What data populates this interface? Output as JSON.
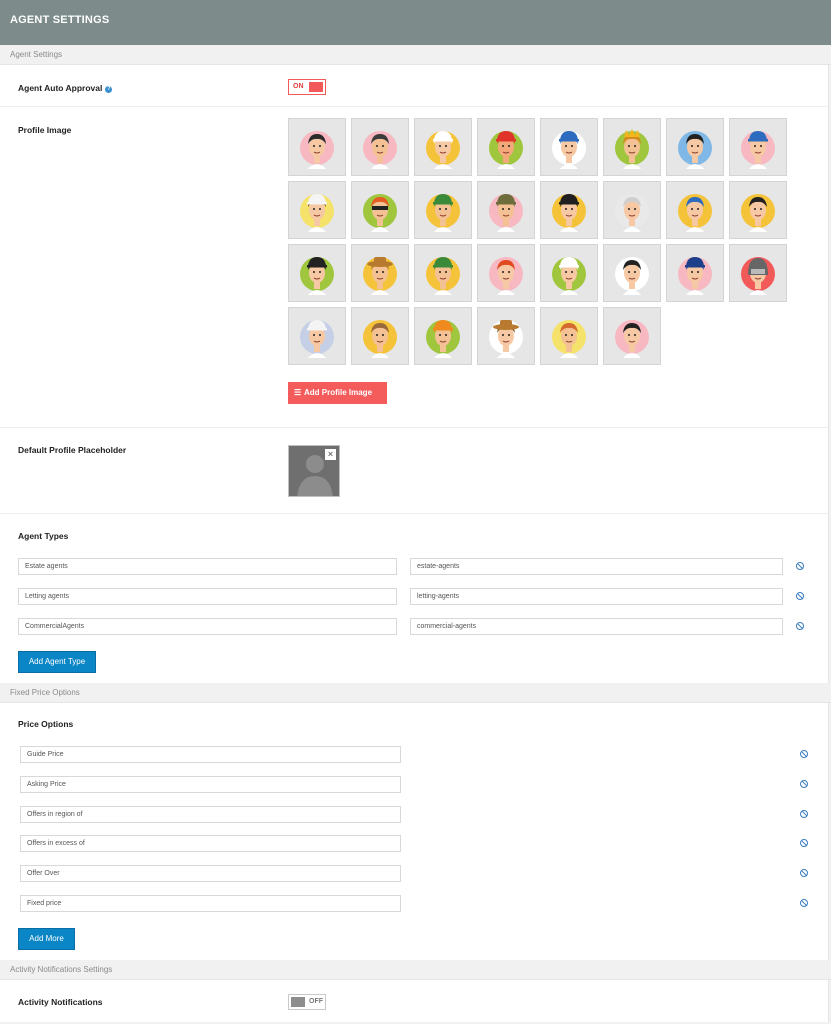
{
  "header": {
    "title": "AGENT SETTINGS"
  },
  "sections": {
    "agent_settings": "Agent Settings",
    "fixed_price": "Fixed Price Options",
    "activity": "Activity Notifications Settings"
  },
  "auto_approval": {
    "label": "Agent Auto Approval",
    "help_icon": "question-icon",
    "toggle_label": "ON",
    "enabled": true
  },
  "profile_image": {
    "label": "Profile Image",
    "avatars": [
      {
        "skin": "#f6c9a4",
        "hair": "#2b2b2b",
        "bg": "#f7b8c1",
        "hat": "none"
      },
      {
        "skin": "#f3c193",
        "hair": "#3b3b3b",
        "bg": "#f7b8c1",
        "hat": "none"
      },
      {
        "skin": "#f6c9a4",
        "hair": "#ffffff",
        "bg": "#f5c33a",
        "hat": "chef"
      },
      {
        "skin": "#f3a97a",
        "hair": "#e04a1e",
        "bg": "#9fc63c",
        "hat": "cap-red"
      },
      {
        "skin": "#f6c9a4",
        "hair": "#2d6bbf",
        "bg": "#ffffff",
        "hat": "cap-blue"
      },
      {
        "skin": "#f3c193",
        "hair": "#d48a1c",
        "bg": "#9fc63c",
        "hat": "crown"
      },
      {
        "skin": "#f6c9a4",
        "hair": "#222222",
        "bg": "#7fb7e6",
        "hat": "none"
      },
      {
        "skin": "#f6c9a4",
        "hair": "#f2c641",
        "bg": "#f7b8c1",
        "hat": "cap-blue"
      },
      {
        "skin": "#f6c9a4",
        "hair": "#6b4324",
        "bg": "#f5e26a",
        "hat": "white"
      },
      {
        "skin": "#f3c193",
        "hair": "#e45b24",
        "bg": "#9fc63c",
        "hat": "mask"
      },
      {
        "skin": "#f3c193",
        "hair": "#3a8a3a",
        "bg": "#f5c33a",
        "hat": "cap-green"
      },
      {
        "skin": "#f3c193",
        "hair": "#6e6e3c",
        "bg": "#f7b8c1",
        "hat": "army"
      },
      {
        "skin": "#f6c9a4",
        "hair": "#222222",
        "bg": "#f5c33a",
        "hat": "pirate"
      },
      {
        "skin": "#f6c9a4",
        "hair": "#cfcfcf",
        "bg": "#e9e9e9",
        "hat": "none"
      },
      {
        "skin": "#f6c9a4",
        "hair": "#2d6bbf",
        "bg": "#f5c33a",
        "hat": "none"
      },
      {
        "skin": "#f6c9a4",
        "hair": "#222222",
        "bg": "#f5c33a",
        "hat": "none"
      },
      {
        "skin": "#f6c9a4",
        "hair": "#222222",
        "bg": "#9fc63c",
        "hat": "officer"
      },
      {
        "skin": "#f3c193",
        "hair": "#b77a2e",
        "bg": "#f5c33a",
        "hat": "cowboy"
      },
      {
        "skin": "#f3c193",
        "hair": "#4c8a4c",
        "bg": "#f5c33a",
        "hat": "cap-green"
      },
      {
        "skin": "#f6c9a4",
        "hair": "#e04a1e",
        "bg": "#f7b8c1",
        "hat": "none"
      },
      {
        "skin": "#f6c9a4",
        "hair": "#ffffff",
        "bg": "#9fc63c",
        "hat": "sailor"
      },
      {
        "skin": "#f6c9a4",
        "hair": "#222222",
        "bg": "#ffffff",
        "hat": "none"
      },
      {
        "skin": "#f6c9a4",
        "hair": "#2d4fa0",
        "bg": "#f7b8c1",
        "hat": "police"
      },
      {
        "skin": "#f6c9a4",
        "hair": "#555555",
        "bg": "#f25a5a",
        "hat": "helmet"
      },
      {
        "skin": "#f6c9a4",
        "hair": "#b8c8e0",
        "bg": "#c5cfe6",
        "hat": "white"
      },
      {
        "skin": "#f3c193",
        "hair": "#9a6a3a",
        "bg": "#f5c33a",
        "hat": "none"
      },
      {
        "skin": "#f3c193",
        "hair": "#f08a1e",
        "bg": "#9fc63c",
        "hat": "cap-orange"
      },
      {
        "skin": "#f6c9a4",
        "hair": "#8a5a2e",
        "bg": "#ffffff",
        "hat": "cowboy"
      },
      {
        "skin": "#f3c193",
        "hair": "#d46a2e",
        "bg": "#f5e26a",
        "hat": "none"
      },
      {
        "skin": "#f6c9a4",
        "hair": "#222222",
        "bg": "#f7b8c1",
        "hat": "none"
      }
    ],
    "add_button": "Add Profile Image",
    "add_icon": "list-icon"
  },
  "default_placeholder": {
    "label": "Default Profile Placeholder",
    "close_icon": "close-icon",
    "close_glyph": "×"
  },
  "agent_types": {
    "label": "Agent Types",
    "rows": [
      {
        "name": "Estate agents",
        "slug": "estate-agents"
      },
      {
        "name": "Letting agents",
        "slug": "letting-agents"
      },
      {
        "name": "CommercialAgents",
        "slug": "commercial-agents"
      }
    ],
    "add_button": "Add Agent Type"
  },
  "price_options": {
    "label": "Price Options",
    "rows": [
      "Guide Price",
      "Asking Price",
      "Offers in region of",
      "Offers in excess of",
      "Offer Over",
      "Fixed price"
    ],
    "add_button": "Add More"
  },
  "activity_notifications": {
    "label": "Activity Notifications",
    "toggle_label": "OFF",
    "enabled": false
  }
}
